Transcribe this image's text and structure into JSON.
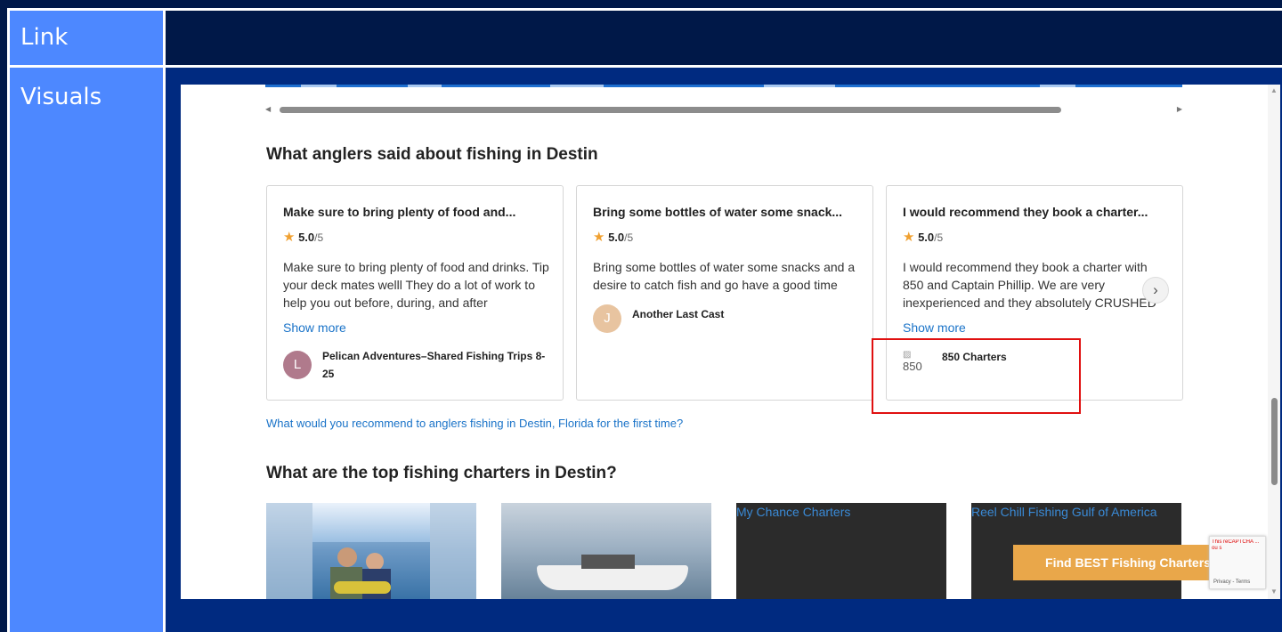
{
  "table": {
    "row1_label": "Link",
    "row2_label": "Visuals"
  },
  "reviews_section": {
    "heading": "What anglers said about fishing in Destin",
    "cards": [
      {
        "title": "Make sure to bring plenty of food and...",
        "score": "5.0",
        "outof": "/5",
        "body": "Make sure to bring plenty of food and drinks. Tip your deck mates welll They do a lot of work to help you out before, during, and after",
        "show_more": "Show more",
        "avatar_letter": "L",
        "avatar_color": "#b07a8c",
        "author": "Pelican Adventures–Shared Fishing Trips 8-25"
      },
      {
        "title": "Bring some bottles of water some snack...",
        "score": "5.0",
        "outof": "/5",
        "body": "Bring some bottles of water some snacks and a desire to catch fish and go have a good time",
        "avatar_letter": "J",
        "avatar_color": "#e8c4a0",
        "author": "Another Last Cast"
      },
      {
        "title": "I would recommend they book a charter...",
        "score": "5.0",
        "outof": "/5",
        "body": "I would recommend they book a charter with 850 and Captain Phillip. We are very inexperienced and they absolutely CRUSHED",
        "show_more": "Show more",
        "avatar_alt": "850",
        "author": "850 Charters"
      }
    ],
    "next_arrow": "›"
  },
  "recommend_link": "What would you recommend to anglers fishing in Destin, Florida for the first time?",
  "charters_section": {
    "heading": "What are the top fishing charters in Destin?",
    "cards": [
      {
        "alt": ""
      },
      {
        "alt": ""
      },
      {
        "alt": "My Chance Charters"
      },
      {
        "alt": "Reel Chill Fishing Gulf of America"
      }
    ]
  },
  "cta": {
    "label": "Find BEST Fishing Charters"
  },
  "recaptcha": {
    "note": "This reCAPTCHA ... ou s",
    "terms": "Privacy - Terms"
  },
  "colors": {
    "accent": "#1a73c8",
    "cta": "#e9a74a",
    "star": "#f0a030",
    "highlight": "#e01010"
  }
}
